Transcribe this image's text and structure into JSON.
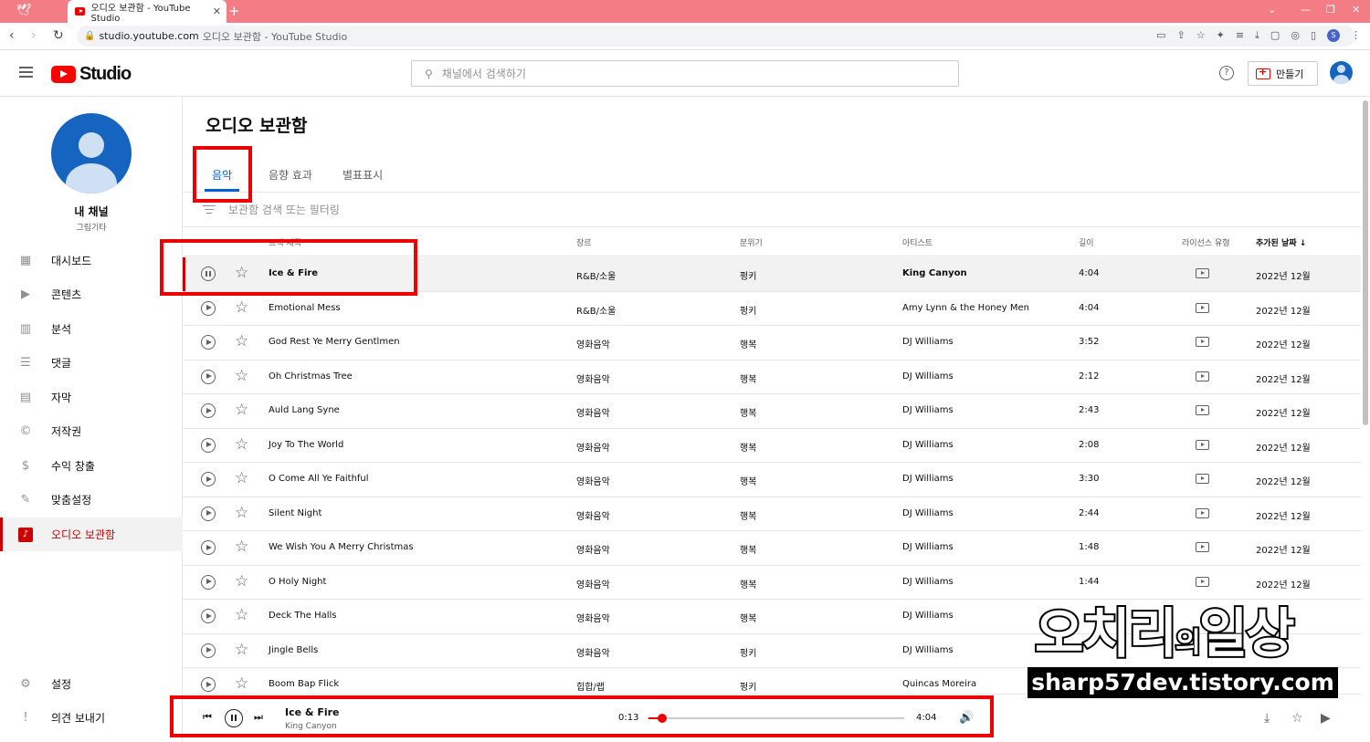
{
  "browser": {
    "tab_title": "오디오 보관함 - YouTube Studio",
    "url_domain": "studio.youtube.com",
    "url_title": "오디오 보관함 - YouTube Studio",
    "profile_initial": "S"
  },
  "header": {
    "logo_text": "Studio",
    "search_placeholder": "채널에서 검색하기",
    "create_label": "만들기"
  },
  "sidebar": {
    "channel_name": "내 채널",
    "channel_sub": "그림기타",
    "items": [
      {
        "label": "대시보드",
        "icon": "dashboard-icon"
      },
      {
        "label": "콘텐츠",
        "icon": "content-icon"
      },
      {
        "label": "분석",
        "icon": "analytics-icon"
      },
      {
        "label": "댓글",
        "icon": "comments-icon"
      },
      {
        "label": "자막",
        "icon": "subtitles-icon"
      },
      {
        "label": "저작권",
        "icon": "copyright-icon"
      },
      {
        "label": "수익 창출",
        "icon": "monetization-icon"
      },
      {
        "label": "맞춤설정",
        "icon": "customization-icon"
      },
      {
        "label": "오디오 보관함",
        "icon": "audio-library-icon"
      }
    ],
    "settings_label": "설정",
    "feedback_label": "의견 보내기"
  },
  "main": {
    "title": "오디오 보관함",
    "tabs": [
      "음악",
      "음향 효과",
      "별표표시"
    ],
    "filter_placeholder": "보관함 검색 또는 필터링",
    "columns": {
      "title": "트랙 제목",
      "genre": "장르",
      "mood": "분위기",
      "artist": "아티스트",
      "length": "길이",
      "license": "라이선스 유형",
      "date": "추가된 날짜"
    },
    "tracks": [
      {
        "title": "Ice & Fire",
        "genre": "R&B/소울",
        "mood": "펑키",
        "artist": "King Canyon",
        "length": "4:04",
        "date": "2022년 12월"
      },
      {
        "title": "Emotional Mess",
        "genre": "R&B/소울",
        "mood": "펑키",
        "artist": "Amy Lynn & the Honey Men",
        "length": "4:04",
        "date": "2022년 12월"
      },
      {
        "title": "God Rest Ye Merry Gentlmen",
        "genre": "영화음악",
        "mood": "행복",
        "artist": "DJ Williams",
        "length": "3:52",
        "date": "2022년 12월"
      },
      {
        "title": "Oh Christmas Tree",
        "genre": "영화음악",
        "mood": "행복",
        "artist": "DJ Williams",
        "length": "2:12",
        "date": "2022년 12월"
      },
      {
        "title": "Auld Lang Syne",
        "genre": "영화음악",
        "mood": "행복",
        "artist": "DJ Williams",
        "length": "2:43",
        "date": "2022년 12월"
      },
      {
        "title": "Joy To The World",
        "genre": "영화음악",
        "mood": "행복",
        "artist": "DJ Williams",
        "length": "2:08",
        "date": "2022년 12월"
      },
      {
        "title": "O Come All Ye Faithful",
        "genre": "영화음악",
        "mood": "행복",
        "artist": "DJ Williams",
        "length": "3:30",
        "date": "2022년 12월"
      },
      {
        "title": "Silent Night",
        "genre": "영화음악",
        "mood": "행복",
        "artist": "DJ Williams",
        "length": "2:44",
        "date": "2022년 12월"
      },
      {
        "title": "We Wish You A Merry Christmas",
        "genre": "영화음악",
        "mood": "행복",
        "artist": "DJ Williams",
        "length": "1:48",
        "date": "2022년 12월"
      },
      {
        "title": "O Holy Night",
        "genre": "영화음악",
        "mood": "행복",
        "artist": "DJ Williams",
        "length": "1:44",
        "date": "2022년 12월"
      },
      {
        "title": "Deck The Halls",
        "genre": "영화음악",
        "mood": "행복",
        "artist": "DJ Williams",
        "length": "",
        "date": ""
      },
      {
        "title": "Jingle Bells",
        "genre": "영화음악",
        "mood": "펑키",
        "artist": "DJ Williams",
        "length": "",
        "date": ""
      },
      {
        "title": "Boom Bap Flick",
        "genre": "힙합/랩",
        "mood": "펑키",
        "artist": "Quincas Moreira",
        "length": "",
        "date": ""
      }
    ]
  },
  "player": {
    "track": "Ice & Fire",
    "artist": "King Canyon",
    "current_time": "0:13",
    "total_time": "4:04",
    "progress_fraction": 0.053
  },
  "watermark": {
    "line1_a": "오치리",
    "line1_b": "의",
    "line1_c": "일상",
    "line2": "sharp57dev.tistory.com"
  }
}
